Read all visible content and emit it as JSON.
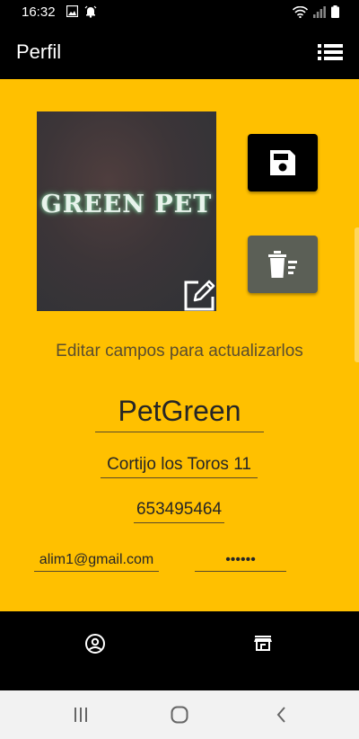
{
  "status_bar": {
    "time": "16:32",
    "icons": [
      "image-icon",
      "alarm-icon",
      "wifi-icon",
      "signal-icon",
      "battery-icon"
    ]
  },
  "app_bar": {
    "title": "Perfil",
    "menu_icon": "list-menu-icon"
  },
  "profile": {
    "image_text": "GREEN PET",
    "edit_icon": "edit-icon",
    "save_icon": "save-icon",
    "delete_icon": "delete-list-icon",
    "hint": "Editar campos para actualizarlos",
    "fields": {
      "name": "PetGreen",
      "address": "Cortijo los Toros 11",
      "phone": "653495464",
      "email": "alim1@gmail.com",
      "password": "••••••"
    }
  },
  "bottom_nav": {
    "items": [
      {
        "icon": "account-circle-icon"
      },
      {
        "icon": "store-icon"
      }
    ]
  },
  "system_nav": {
    "items": [
      {
        "icon": "recent-apps-icon"
      },
      {
        "icon": "home-icon"
      },
      {
        "icon": "back-icon"
      }
    ]
  },
  "colors": {
    "accent": "#ffc000",
    "bar": "#000000",
    "delete_button": "#5b5f56",
    "hint_text": "#5a4d2e"
  }
}
